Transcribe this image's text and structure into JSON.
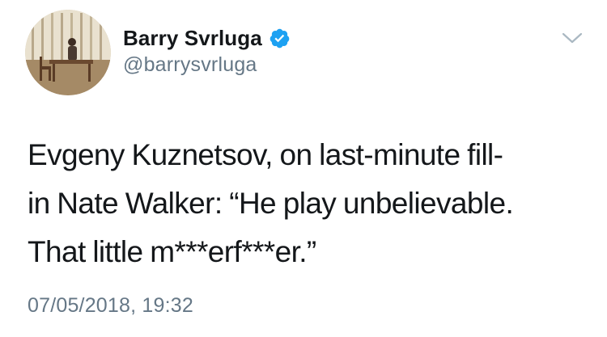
{
  "author": {
    "display_name": "Barry Svrluga",
    "handle": "@barrysvrluga",
    "verified": true
  },
  "tweet": {
    "text_lines": [
      "Evgeny Kuznetsov, on last-minute fill-",
      "in Nate Walker: “He play unbelievable.",
      "That little m***erf***er.”"
    ],
    "timestamp": "07/05/2018, 19:32"
  },
  "icons": {
    "verified_badge": "verified-badge-icon",
    "menu_chevron": "chevron-down-icon"
  },
  "colors": {
    "name_text": "#14171a",
    "secondary_text": "#657786",
    "verified_blue": "#1da1f2",
    "chevron_gray": "#aab8c2"
  }
}
